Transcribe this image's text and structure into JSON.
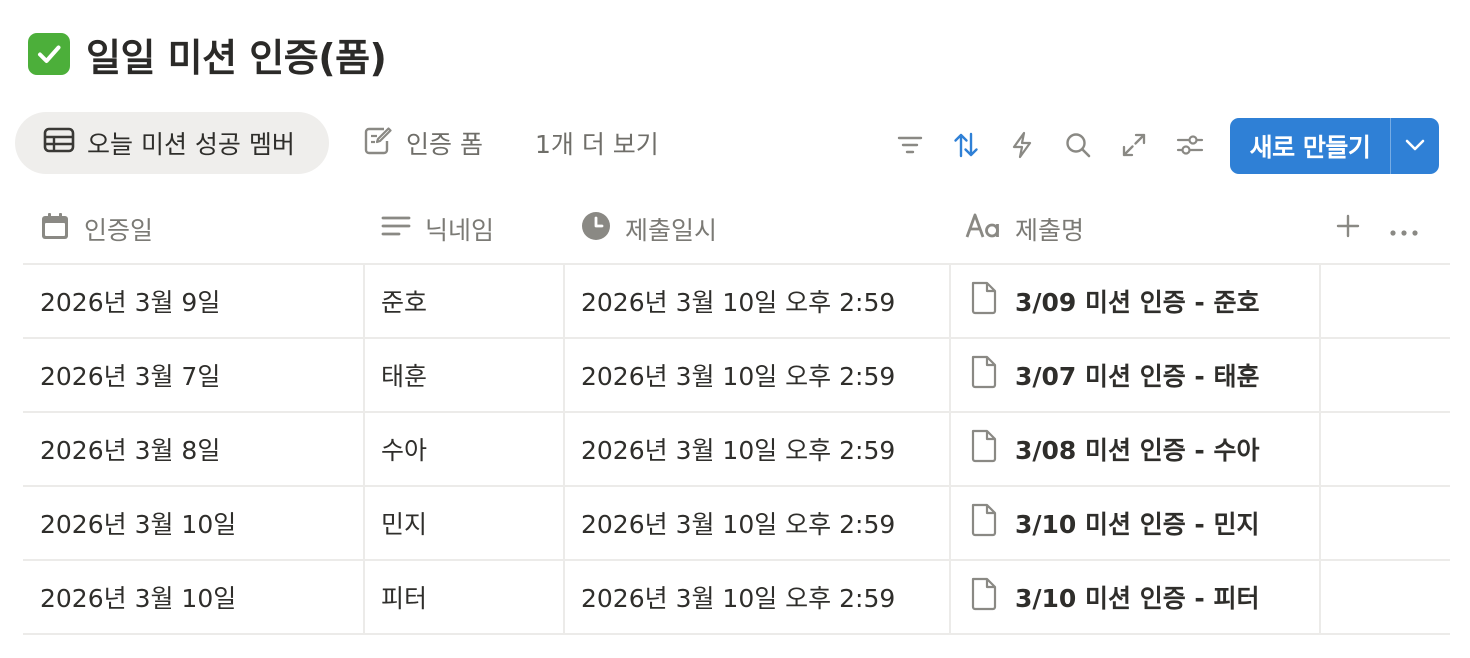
{
  "page": {
    "title": "일일 미션 인증(폼)",
    "title_icon": "white-check-mark-icon"
  },
  "views": {
    "active_label": "오늘 미션 성공 멤버",
    "form_label": "인증 폼",
    "more_label": "1개 더 보기"
  },
  "toolbar": {
    "new_label": "새로 만들기",
    "accent_color": "#2f80d6"
  },
  "table": {
    "columns": [
      {
        "label": "인증일",
        "icon": "calendar-icon"
      },
      {
        "label": "닉네임",
        "icon": "text-lines-icon"
      },
      {
        "label": "제출일시",
        "icon": "clock-icon"
      },
      {
        "label": "제출명",
        "icon": "aa-title-icon"
      }
    ],
    "rows": [
      {
        "date": "2026년 3월 9일",
        "nickname": "준호",
        "submitted": "2026년 3월 10일 오후 2:59",
        "name": "3/09 미션 인증 - 준호"
      },
      {
        "date": "2026년 3월 7일",
        "nickname": "태훈",
        "submitted": "2026년 3월 10일 오후 2:59",
        "name": "3/07 미션 인증 - 태훈"
      },
      {
        "date": "2026년 3월 8일",
        "nickname": "수아",
        "submitted": "2026년 3월 10일 오후 2:59",
        "name": "3/08 미션 인증 - 수아"
      },
      {
        "date": "2026년 3월 10일",
        "nickname": "민지",
        "submitted": "2026년 3월 10일 오후 2:59",
        "name": "3/10 미션 인증 - 민지"
      },
      {
        "date": "2026년 3월 10일",
        "nickname": "피터",
        "submitted": "2026년 3월 10일 오후 2:59",
        "name": "3/10 미션 인증 - 피터"
      }
    ]
  }
}
